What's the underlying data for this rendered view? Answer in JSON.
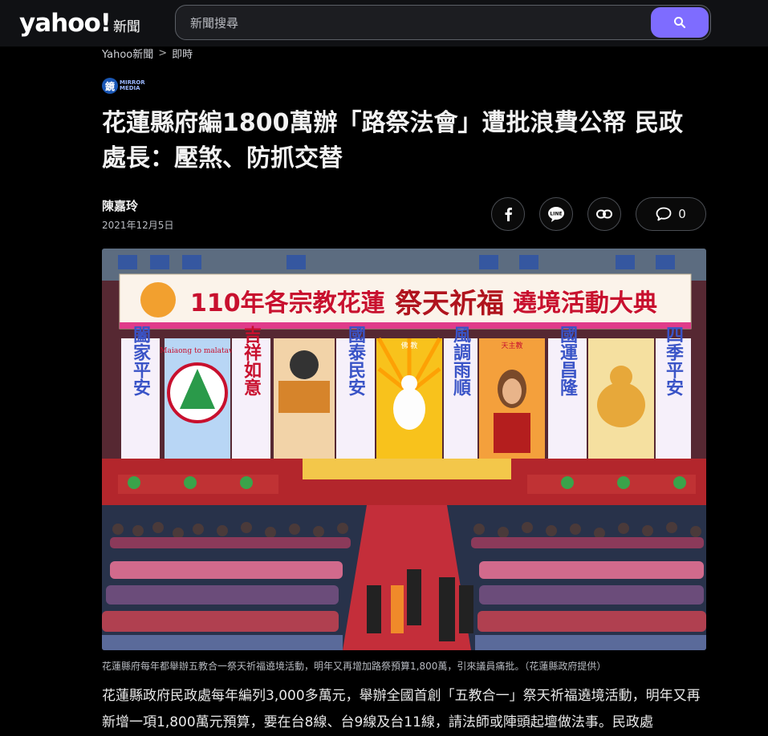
{
  "header": {
    "logo_word": "yahoo!",
    "logo_section": "新聞",
    "search_placeholder": "新聞搜尋"
  },
  "breadcrumb": [
    "Yahoo新聞",
    ">",
    "即時"
  ],
  "source": {
    "badge": "鏡",
    "text_line1": "MIRROR",
    "text_line2": "MEDIA"
  },
  "article": {
    "title": "花蓮縣府編1800萬辦「路祭法會」遭批浪費公帑 民政處長：壓煞、防抓交替",
    "author": "陳嘉玲",
    "date": "2021年12月5日",
    "comment_count": "0",
    "photo": {
      "banner_text": "110年各宗教花蓮",
      "banner_calligraphy": "祭天祈福",
      "banner_text_2": "遶境活動大典",
      "left_banner_1": "闔家平安",
      "left_banner_2": "吉祥如意",
      "mid_banner": "國泰民安",
      "mid_banner_2": "風調雨順",
      "right_banner_1": "國運昌隆",
      "right_banner_2": "四季平安",
      "mini_label": "Maiaong to malataw",
      "sign_1": "佛 教",
      "sign_2": "天主教"
    },
    "caption": "花蓮縣府每年都舉辦五教合一祭天祈福遶境活動，明年又再增加路祭預算1,800萬，引來議員痛批。（花蓮縣政府提供）",
    "body": "花蓮縣政府民政處每年編列3,000多萬元，舉辦全國首創「五教合一」祭天祈福遶境活動，明年又再新增一項1,800萬元預算，要在台8線、台9線及台11線，請法師或陣頭起壇做法事。民政處"
  },
  "colors": {
    "accent": "#7e6cff",
    "background": "#000000",
    "header_bg": "#101114"
  },
  "icons": [
    "search-icon",
    "facebook-icon",
    "line-icon",
    "link-icon",
    "comment-icon"
  ]
}
